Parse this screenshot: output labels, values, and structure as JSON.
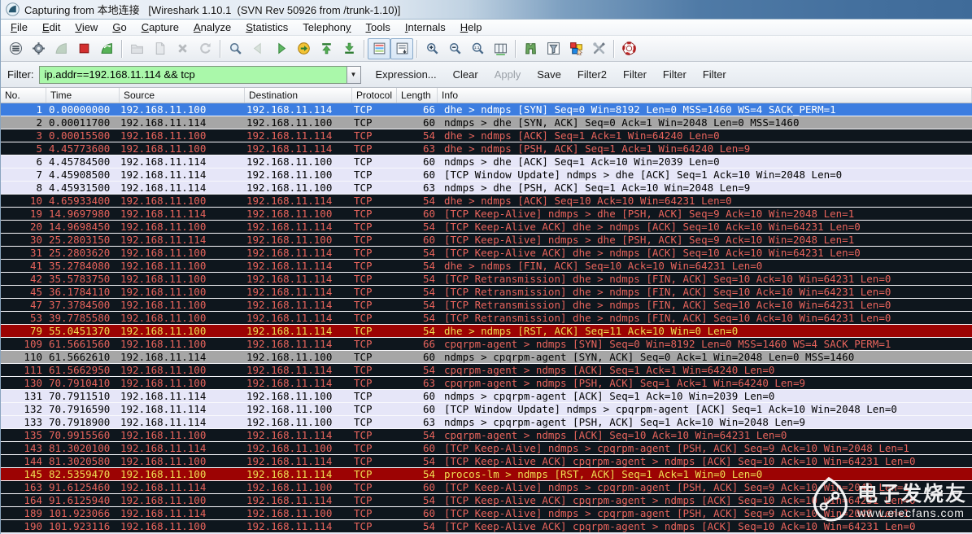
{
  "window": {
    "title": "Capturing from 本地连接   [Wireshark 1.10.1  (SVN Rev 50926 from /trunk-1.10)]"
  },
  "menu": {
    "items": [
      {
        "label": "File",
        "u": 0
      },
      {
        "label": "Edit",
        "u": 0
      },
      {
        "label": "View",
        "u": 0
      },
      {
        "label": "Go",
        "u": 0
      },
      {
        "label": "Capture",
        "u": 0
      },
      {
        "label": "Analyze",
        "u": 0
      },
      {
        "label": "Statistics",
        "u": 0
      },
      {
        "label": "Telephony",
        "u": 8
      },
      {
        "label": "Tools",
        "u": 0
      },
      {
        "label": "Internals",
        "u": 0
      },
      {
        "label": "Help",
        "u": 0
      }
    ]
  },
  "toolbar": {
    "groups": [
      [
        "list-interfaces",
        "capture-options",
        "capture-start",
        "capture-stop",
        "capture-restart"
      ],
      [
        "file-open",
        "file-save",
        "file-close",
        "reload"
      ],
      [
        "find",
        "go-back",
        "go-forward",
        "go-to-packet",
        "go-top",
        "go-bottom"
      ],
      [
        "colorize",
        "autoscroll"
      ],
      [
        "zoom-in",
        "zoom-out",
        "zoom-actual",
        "resize-columns"
      ],
      [
        "capture-filter",
        "display-filter",
        "coloring-rules",
        "preferences"
      ],
      [
        "help"
      ]
    ],
    "pressed": [
      "colorize",
      "autoscroll"
    ],
    "disabled": [
      "capture-start",
      "file-open",
      "file-save",
      "file-close",
      "reload",
      "go-back"
    ]
  },
  "filter_bar": {
    "label": "Filter:",
    "value": "ip.addr==192.168.11.114 && tcp",
    "buttons": [
      {
        "label": "Expression...",
        "disabled": false
      },
      {
        "label": "Clear",
        "disabled": false
      },
      {
        "label": "Apply",
        "disabled": true
      },
      {
        "label": "Save",
        "disabled": false
      },
      {
        "label": "Filter2",
        "disabled": false
      },
      {
        "label": "Filter",
        "disabled": false
      },
      {
        "label": "Filter",
        "disabled": false
      },
      {
        "label": "Filter",
        "disabled": false
      }
    ]
  },
  "packet_list": {
    "columns": [
      "No.",
      "Time",
      "Source",
      "Destination",
      "Protocol",
      "Length",
      "Info"
    ],
    "rows": [
      {
        "no": "1",
        "time": "0.00000000",
        "src": "192.168.11.100",
        "dst": "192.168.11.114",
        "proto": "TCP",
        "len": "66",
        "info": "dhe > ndmps [SYN] Seq=0 Win=8192 Len=0 MSS=1460 WS=4 SACK_PERM=1",
        "style": "selected"
      },
      {
        "no": "2",
        "time": "0.00011700",
        "src": "192.168.11.114",
        "dst": "192.168.11.100",
        "proto": "TCP",
        "len": "60",
        "info": "ndmps > dhe [SYN, ACK] Seq=0 Ack=1 Win=2048 Len=0 MSS=1460",
        "style": "gray"
      },
      {
        "no": "3",
        "time": "0.00015500",
        "src": "192.168.11.100",
        "dst": "192.168.11.114",
        "proto": "TCP",
        "len": "54",
        "info": "dhe > ndmps [ACK] Seq=1 Ack=1 Win=64240 Len=0",
        "style": "dark"
      },
      {
        "no": "5",
        "time": "4.45773600",
        "src": "192.168.11.100",
        "dst": "192.168.11.114",
        "proto": "TCP",
        "len": "63",
        "info": "dhe > ndmps [PSH, ACK] Seq=1 Ack=1 Win=64240 Len=9",
        "style": "dark"
      },
      {
        "no": "6",
        "time": "4.45784500",
        "src": "192.168.11.114",
        "dst": "192.168.11.100",
        "proto": "TCP",
        "len": "60",
        "info": "ndmps > dhe [ACK] Seq=1 Ack=10 Win=2039 Len=0",
        "style": "light"
      },
      {
        "no": "7",
        "time": "4.45908500",
        "src": "192.168.11.114",
        "dst": "192.168.11.100",
        "proto": "TCP",
        "len": "60",
        "info": "[TCP Window Update] ndmps > dhe [ACK] Seq=1 Ack=10 Win=2048 Len=0",
        "style": "light"
      },
      {
        "no": "8",
        "time": "4.45931500",
        "src": "192.168.11.114",
        "dst": "192.168.11.100",
        "proto": "TCP",
        "len": "63",
        "info": "ndmps > dhe [PSH, ACK] Seq=1 Ack=10 Win=2048 Len=9",
        "style": "light"
      },
      {
        "no": "10",
        "time": "4.65933400",
        "src": "192.168.11.100",
        "dst": "192.168.11.114",
        "proto": "TCP",
        "len": "54",
        "info": "dhe > ndmps [ACK] Seq=10 Ack=10 Win=64231 Len=0",
        "style": "dark"
      },
      {
        "no": "19",
        "time": "14.9697980",
        "src": "192.168.11.114",
        "dst": "192.168.11.100",
        "proto": "TCP",
        "len": "60",
        "info": "[TCP Keep-Alive] ndmps > dhe [PSH, ACK] Seq=9 Ack=10 Win=2048 Len=1",
        "style": "dark"
      },
      {
        "no": "20",
        "time": "14.9698450",
        "src": "192.168.11.100",
        "dst": "192.168.11.114",
        "proto": "TCP",
        "len": "54",
        "info": "[TCP Keep-Alive ACK] dhe > ndmps [ACK] Seq=10 Ack=10 Win=64231 Len=0",
        "style": "dark"
      },
      {
        "no": "30",
        "time": "25.2803150",
        "src": "192.168.11.114",
        "dst": "192.168.11.100",
        "proto": "TCP",
        "len": "60",
        "info": "[TCP Keep-Alive] ndmps > dhe [PSH, ACK] Seq=9 Ack=10 Win=2048 Len=1",
        "style": "dark"
      },
      {
        "no": "31",
        "time": "25.2803620",
        "src": "192.168.11.100",
        "dst": "192.168.11.114",
        "proto": "TCP",
        "len": "54",
        "info": "[TCP Keep-Alive ACK] dhe > ndmps [ACK] Seq=10 Ack=10 Win=64231 Len=0",
        "style": "dark"
      },
      {
        "no": "41",
        "time": "35.2784080",
        "src": "192.168.11.100",
        "dst": "192.168.11.114",
        "proto": "TCP",
        "len": "54",
        "info": "dhe > ndmps [FIN, ACK] Seq=10 Ack=10 Win=64231 Len=0",
        "style": "dark"
      },
      {
        "no": "42",
        "time": "35.5783750",
        "src": "192.168.11.100",
        "dst": "192.168.11.114",
        "proto": "TCP",
        "len": "54",
        "info": "[TCP Retransmission] dhe > ndmps [FIN, ACK] Seq=10 Ack=10 Win=64231 Len=0",
        "style": "dark"
      },
      {
        "no": "45",
        "time": "36.1784110",
        "src": "192.168.11.100",
        "dst": "192.168.11.114",
        "proto": "TCP",
        "len": "54",
        "info": "[TCP Retransmission] dhe > ndmps [FIN, ACK] Seq=10 Ack=10 Win=64231 Len=0",
        "style": "dark"
      },
      {
        "no": "47",
        "time": "37.3784500",
        "src": "192.168.11.100",
        "dst": "192.168.11.114",
        "proto": "TCP",
        "len": "54",
        "info": "[TCP Retransmission] dhe > ndmps [FIN, ACK] Seq=10 Ack=10 Win=64231 Len=0",
        "style": "dark"
      },
      {
        "no": "53",
        "time": "39.7785580",
        "src": "192.168.11.100",
        "dst": "192.168.11.114",
        "proto": "TCP",
        "len": "54",
        "info": "[TCP Retransmission] dhe > ndmps [FIN, ACK] Seq=10 Ack=10 Win=64231 Len=0",
        "style": "dark"
      },
      {
        "no": "79",
        "time": "55.0451370",
        "src": "192.168.11.100",
        "dst": "192.168.11.114",
        "proto": "TCP",
        "len": "54",
        "info": "dhe > ndmps [RST, ACK] Seq=11 Ack=10 Win=0 Len=0",
        "style": "red"
      },
      {
        "no": "109",
        "time": "61.5661560",
        "src": "192.168.11.100",
        "dst": "192.168.11.114",
        "proto": "TCP",
        "len": "66",
        "info": "cpqrpm-agent > ndmps [SYN] Seq=0 Win=8192 Len=0 MSS=1460 WS=4 SACK_PERM=1",
        "style": "dark"
      },
      {
        "no": "110",
        "time": "61.5662610",
        "src": "192.168.11.114",
        "dst": "192.168.11.100",
        "proto": "TCP",
        "len": "60",
        "info": "ndmps > cpqrpm-agent [SYN, ACK] Seq=0 Ack=1 Win=2048 Len=0 MSS=1460",
        "style": "gray"
      },
      {
        "no": "111",
        "time": "61.5662950",
        "src": "192.168.11.100",
        "dst": "192.168.11.114",
        "proto": "TCP",
        "len": "54",
        "info": "cpqrpm-agent > ndmps [ACK] Seq=1 Ack=1 Win=64240 Len=0",
        "style": "dark"
      },
      {
        "no": "130",
        "time": "70.7910410",
        "src": "192.168.11.100",
        "dst": "192.168.11.114",
        "proto": "TCP",
        "len": "63",
        "info": "cpqrpm-agent > ndmps [PSH, ACK] Seq=1 Ack=1 Win=64240 Len=9",
        "style": "dark"
      },
      {
        "no": "131",
        "time": "70.7911510",
        "src": "192.168.11.114",
        "dst": "192.168.11.100",
        "proto": "TCP",
        "len": "60",
        "info": "ndmps > cpqrpm-agent [ACK] Seq=1 Ack=10 Win=2039 Len=0",
        "style": "light"
      },
      {
        "no": "132",
        "time": "70.7916590",
        "src": "192.168.11.114",
        "dst": "192.168.11.100",
        "proto": "TCP",
        "len": "60",
        "info": "[TCP Window Update] ndmps > cpqrpm-agent [ACK] Seq=1 Ack=10 Win=2048 Len=0",
        "style": "light"
      },
      {
        "no": "133",
        "time": "70.7918900",
        "src": "192.168.11.114",
        "dst": "192.168.11.100",
        "proto": "TCP",
        "len": "63",
        "info": "ndmps > cpqrpm-agent [PSH, ACK] Seq=1 Ack=10 Win=2048 Len=9",
        "style": "light"
      },
      {
        "no": "135",
        "time": "70.9915560",
        "src": "192.168.11.100",
        "dst": "192.168.11.114",
        "proto": "TCP",
        "len": "54",
        "info": "cpqrpm-agent > ndmps [ACK] Seq=10 Ack=10 Win=64231 Len=0",
        "style": "dark"
      },
      {
        "no": "143",
        "time": "81.3020100",
        "src": "192.168.11.114",
        "dst": "192.168.11.100",
        "proto": "TCP",
        "len": "60",
        "info": "[TCP Keep-Alive] ndmps > cpqrpm-agent [PSH, ACK] Seq=9 Ack=10 Win=2048 Len=1",
        "style": "dark"
      },
      {
        "no": "144",
        "time": "81.3020580",
        "src": "192.168.11.100",
        "dst": "192.168.11.114",
        "proto": "TCP",
        "len": "54",
        "info": "[TCP Keep-Alive ACK] cpqrpm-agent > ndmps [ACK] Seq=10 Ack=10 Win=64231 Len=0",
        "style": "dark"
      },
      {
        "no": "145",
        "time": "82.5359470",
        "src": "192.168.11.100",
        "dst": "192.168.11.114",
        "proto": "TCP",
        "len": "54",
        "info": "procos-lm > ndmps [RST, ACK] Seq=1 Ack=1 Win=0 Len=0",
        "style": "red"
      },
      {
        "no": "163",
        "time": "91.6125460",
        "src": "192.168.11.114",
        "dst": "192.168.11.100",
        "proto": "TCP",
        "len": "60",
        "info": "[TCP Keep-Alive] ndmps > cpqrpm-agent [PSH, ACK] Seq=9 Ack=10 Win=2048 Len=1",
        "style": "dark"
      },
      {
        "no": "164",
        "time": "91.6125940",
        "src": "192.168.11.100",
        "dst": "192.168.11.114",
        "proto": "TCP",
        "len": "54",
        "info": "[TCP Keep-Alive ACK] cpqrpm-agent > ndmps [ACK] Seq=10 Ack=10 Win=64231 Len=0",
        "style": "dark"
      },
      {
        "no": "189",
        "time": "101.923066",
        "src": "192.168.11.114",
        "dst": "192.168.11.100",
        "proto": "TCP",
        "len": "60",
        "info": "[TCP Keep-Alive] ndmps > cpqrpm-agent [PSH, ACK] Seq=9 Ack=10 Win=2048 Len=1",
        "style": "dark"
      },
      {
        "no": "190",
        "time": "101.923116",
        "src": "192.168.11.100",
        "dst": "192.168.11.114",
        "proto": "TCP",
        "len": "54",
        "info": "[TCP Keep-Alive ACK] cpqrpm-agent > ndmps [ACK] Seq=10 Ack=10 Win=64231 Len=0",
        "style": "dark"
      }
    ]
  },
  "watermark": {
    "line1": "电子发烧友",
    "line2": "www.elecfans.com"
  },
  "colors": {
    "selected_row_bg": "#3c7de0",
    "bad_tcp_bg": "#0e161d",
    "bad_tcp_fg": "#e8645c",
    "rst_bg": "#9c0303",
    "rst_fg": "#f0df52",
    "syn_ack_bg": "#a6a6a6",
    "http_like_bg": "#e6e6f8",
    "filter_valid_bg": "#aaf8aa"
  }
}
